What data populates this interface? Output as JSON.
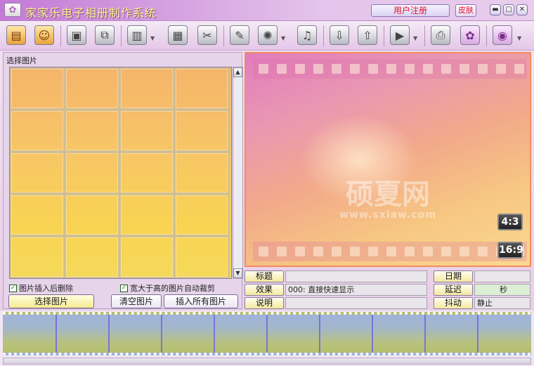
{
  "window": {
    "title": "家家乐电子相册制作系统",
    "register_label": "用户注册",
    "skin_label": "皮肤",
    "app_icon": "album-icon",
    "minimize_glyph": "▬",
    "maximize_glyph": "□",
    "close_glyph": "✕"
  },
  "toolbar": {
    "buttons": [
      {
        "name": "new-album-icon",
        "glyph": "▤"
      },
      {
        "name": "open-album-icon",
        "glyph": "☺"
      },
      {
        "name": "save-icon",
        "glyph": "▣"
      },
      {
        "name": "save-as-icon",
        "glyph": "⧉"
      },
      {
        "name": "add-page-icon",
        "glyph": "▥"
      },
      {
        "name": "page-settings-icon",
        "glyph": "▦"
      },
      {
        "name": "delete-page-icon",
        "glyph": "✂"
      },
      {
        "name": "text-editor-icon",
        "glyph": "✎"
      },
      {
        "name": "effects-icon",
        "glyph": "✺"
      },
      {
        "name": "music-icon",
        "glyph": "♫"
      },
      {
        "name": "import-icon",
        "glyph": "⇩"
      },
      {
        "name": "export-icon",
        "glyph": "⇧"
      },
      {
        "name": "preview-icon",
        "glyph": "▶"
      },
      {
        "name": "print-icon",
        "glyph": "⎙"
      },
      {
        "name": "skin-palette-icon",
        "glyph": "✿"
      },
      {
        "name": "help-disc-icon",
        "glyph": "◉"
      }
    ]
  },
  "left_panel": {
    "title": "选择图片",
    "checkbox_delete_after_insert": {
      "label": "图片插入后删除",
      "checked": true
    },
    "checkbox_auto_crop": {
      "label": "宽大于高的图片自动裁剪",
      "checked": true
    },
    "btn_select": "选择图片",
    "btn_clear": "清空图片",
    "btn_insert_all": "插入所有图片",
    "check_glyph": "✓",
    "scroll_up": "▲",
    "scroll_down": "▼"
  },
  "preview": {
    "watermark_cn": "硕夏网",
    "watermark_en": "www.sxiaw.com",
    "ratio_4_3": "4:3",
    "ratio_16_9": "16:9"
  },
  "properties": {
    "title_label": "标题",
    "title_value": "",
    "effect_label": "效果",
    "effect_value": "000: 直接快速显示",
    "desc_label": "说明",
    "desc_value": "",
    "date_label": "日期",
    "date_value": "",
    "delay_label": "延迟",
    "delay_value": "秒",
    "shake_label": "抖动",
    "shake_value": "静止"
  },
  "colors": {
    "accent": "#c47ad6",
    "title_text": "#fff48a",
    "register_text": "#e0112e",
    "preview_border": "#f28b5f"
  }
}
